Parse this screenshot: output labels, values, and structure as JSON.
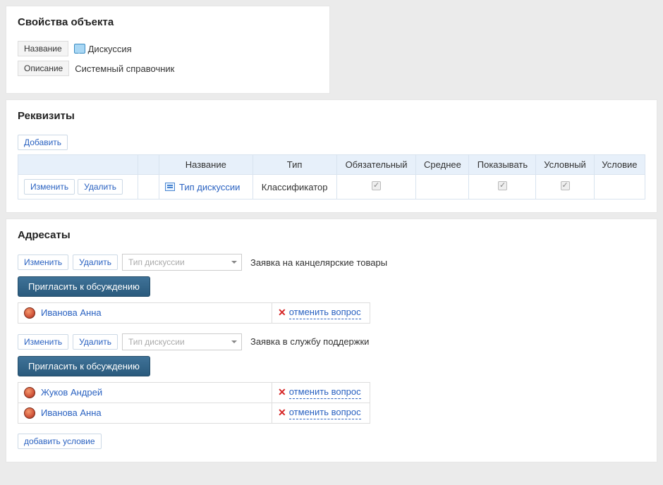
{
  "props": {
    "title": "Свойства объекта",
    "name_label": "Название",
    "name_value": "Дискуссия",
    "desc_label": "Описание",
    "desc_value": "Системный справочник"
  },
  "req": {
    "title": "Реквизиты",
    "add": "Добавить",
    "headers": {
      "name": "Название",
      "type": "Тип",
      "required": "Обязательный",
      "avg": "Среднее",
      "show": "Показывать",
      "cond": "Условный",
      "condition": "Условие"
    },
    "row": {
      "edit": "Изменить",
      "delete": "Удалить",
      "name": "Тип дискуссии",
      "type": "Классификатор"
    }
  },
  "addr": {
    "title": "Адресаты",
    "edit": "Изменить",
    "delete": "Удалить",
    "select_placeholder": "Тип дискуссии",
    "invite": "Пригласить к обсуждению",
    "cancel": "отменить вопрос",
    "add_condition": "добавить условие",
    "groups": [
      {
        "request": "Заявка на канцелярские товары",
        "users": [
          "Иванова Анна"
        ]
      },
      {
        "request": "Заявка в службу поддержки",
        "users": [
          "Жуков Андрей",
          "Иванова Анна"
        ]
      }
    ]
  }
}
